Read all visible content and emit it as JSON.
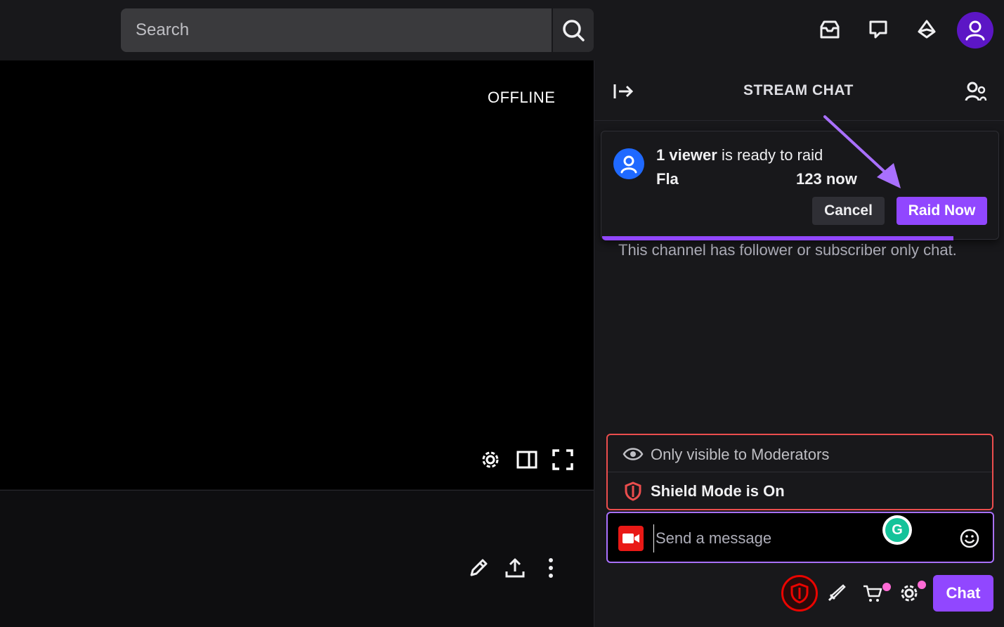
{
  "header": {
    "search_placeholder": "Search"
  },
  "player": {
    "status": "OFFLINE"
  },
  "chat": {
    "title": "STREAM CHAT",
    "raid": {
      "viewers": "1 viewer",
      "ready_text": " is ready to raid",
      "target": "Fla",
      "countdown": "123 now",
      "cancel_label": "Cancel",
      "raid_now_label": "Raid Now"
    },
    "notice": "This channel has follower or subscriber only chat.",
    "moderation": {
      "visibility_text": "Only visible to Moderators",
      "shield_text": "Shield Mode is On"
    },
    "input": {
      "placeholder": "Send a message",
      "grammarly_letter": "G"
    },
    "chat_button_label": "Chat"
  },
  "colors": {
    "accent": "#9147ff",
    "shield_red": "#eb4d4d",
    "raid_avatar": "#1f69ff"
  }
}
